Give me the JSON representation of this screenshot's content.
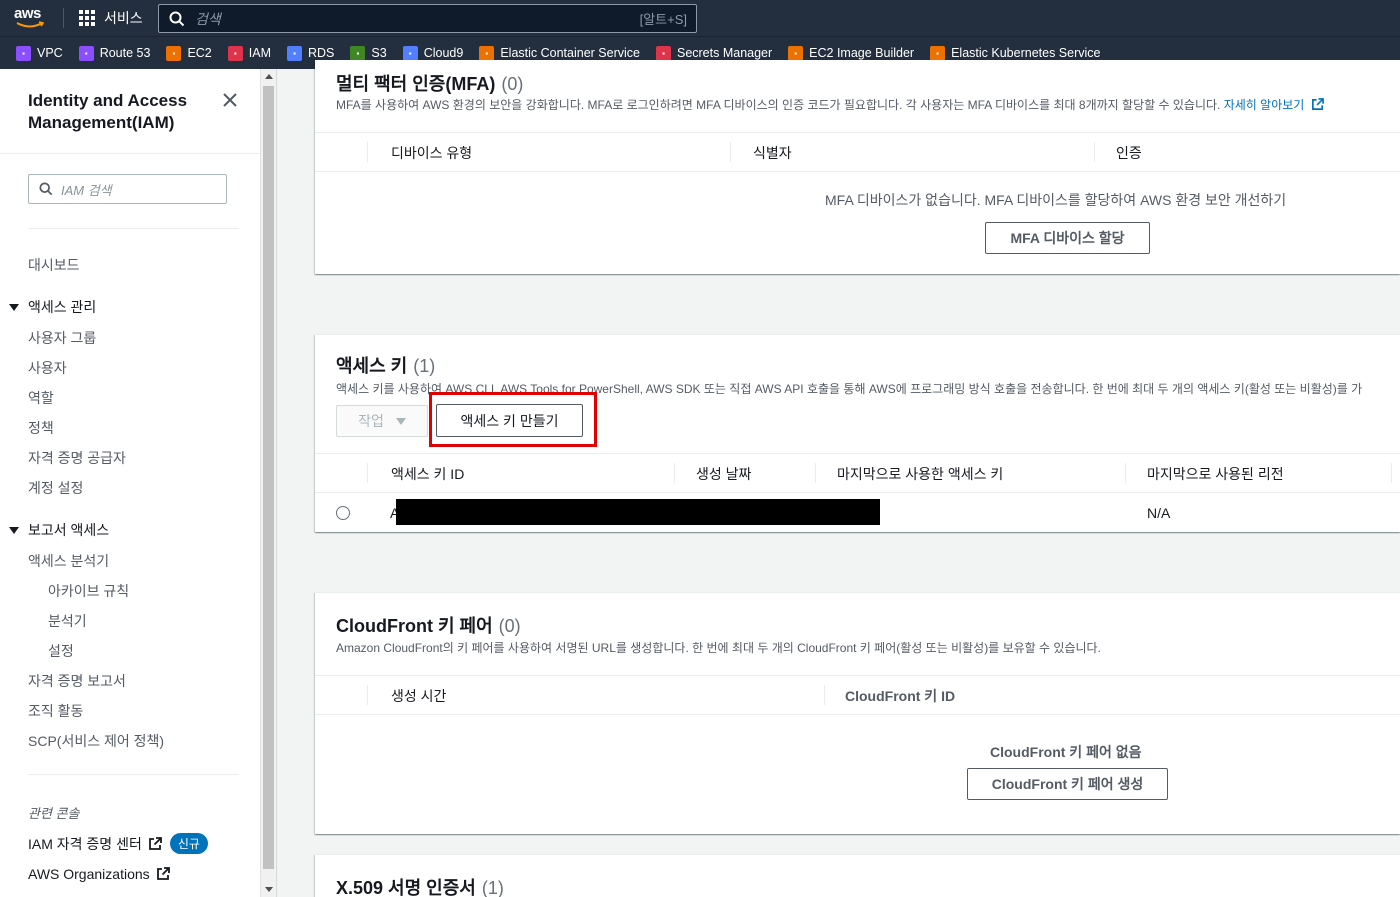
{
  "topnav": {
    "logo": "aws",
    "services_label": "서비스",
    "search_placeholder": "검색",
    "search_shortcut": "[알트+S]"
  },
  "favorites": [
    {
      "label": "VPC",
      "icon": "vpc-icon",
      "color": "#8c4fff"
    },
    {
      "label": "Route 53",
      "icon": "route53-icon",
      "color": "#8c4fff"
    },
    {
      "label": "EC2",
      "icon": "ec2-icon",
      "color": "#ed7100"
    },
    {
      "label": "IAM",
      "icon": "iam-icon",
      "color": "#dd344c"
    },
    {
      "label": "RDS",
      "icon": "rds-icon",
      "color": "#527fff"
    },
    {
      "label": "S3",
      "icon": "s3-icon",
      "color": "#3f8624"
    },
    {
      "label": "Cloud9",
      "icon": "cloud9-icon",
      "color": "#527fff"
    },
    {
      "label": "Elastic Container Service",
      "icon": "ecs-icon",
      "color": "#ed7100"
    },
    {
      "label": "Secrets Manager",
      "icon": "secrets-manager-icon",
      "color": "#dd344c"
    },
    {
      "label": "EC2 Image Builder",
      "icon": "image-builder-icon",
      "color": "#ed7100"
    },
    {
      "label": "Elastic Kubernetes Service",
      "icon": "eks-icon",
      "color": "#ed7100"
    }
  ],
  "sidebar": {
    "title": "Identity and Access Management(IAM)",
    "search_placeholder": "IAM 검색",
    "dashboard": "대시보드",
    "access_management": {
      "label": "액세스 관리",
      "items": [
        "사용자 그룹",
        "사용자",
        "역할",
        "정책",
        "자격 증명 공급자",
        "계정 설정"
      ]
    },
    "access_reports": {
      "label": "보고서 액세스",
      "analyzer": "액세스 분석기",
      "analyzer_sub": [
        "아카이브 규칙",
        "분석기",
        "설정"
      ],
      "items": [
        "자격 증명 보고서",
        "조직 활동",
        "SCP(서비스 제어 정책)"
      ]
    },
    "related_label": "관련 콘솔",
    "related": {
      "identity_center": "IAM 자격 증명 센터",
      "new_badge": "신규",
      "organizations": "AWS Organizations"
    }
  },
  "mfa": {
    "title": "멀티 팩터 인증(MFA)",
    "count": "(0)",
    "description": "MFA를 사용하여 AWS 환경의 보안을 강화합니다. MFA로 로그인하려면 MFA 디바이스의 인증 코드가 필요합니다. 각 사용자는 MFA 디바이스를 최대 8개까지 할당할 수 있습니다.",
    "learn_more": "자세히 알아보기",
    "columns": [
      "디바이스 유형",
      "식별자",
      "인증"
    ],
    "empty_text": "MFA 디바이스가 없습니다. MFA 디바이스를 할당하여 AWS 환경 보안 개선하기",
    "assign_button": "MFA 디바이스 할당"
  },
  "access_keys": {
    "title": "액세스 키",
    "count": "(1)",
    "description": "액세스 키를 사용하여 AWS CLI, AWS Tools for PowerShell, AWS SDK 또는 직접 AWS API 호출을 통해 AWS에 프로그래밍 방식 호출을 전송합니다. 한 번에 최대 두 개의 액세스 키(활성 또는 비활성)를 가",
    "actions_button": "작업",
    "create_button": "액세스 키 만들기",
    "columns": [
      "액세스 키 ID",
      "생성 날짜",
      "마지막으로 사용한 액세스 키",
      "마지막으로 사용된 리전"
    ],
    "rows": [
      {
        "key_id": "A",
        "last_region": "N/A"
      }
    ],
    "highlight_color": "#e00000"
  },
  "cloudfront": {
    "title": "CloudFront 키 페어",
    "count": "(0)",
    "description": "Amazon CloudFront의 키 페어를 사용하여 서명된 URL를 생성합니다. 한 번에 최대 두 개의 CloudFront 키 페어(활성 또는 비활성)를 보유할 수 있습니다.",
    "columns": [
      "생성 시간",
      "CloudFront 키 ID"
    ],
    "empty_text": "CloudFront 키 페어 없음",
    "create_button": "CloudFront 키 페어 생성"
  },
  "x509": {
    "title": "X.509 서명 인증서",
    "count": "(1)"
  }
}
